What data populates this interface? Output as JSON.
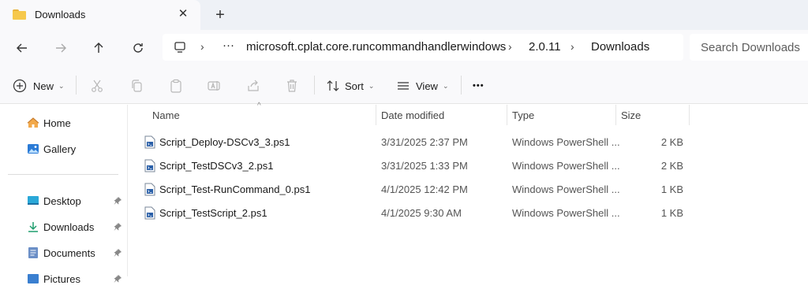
{
  "tab": {
    "title": "Downloads",
    "close_glyph": "✕",
    "new_tab_glyph": "+"
  },
  "address": {
    "more_glyph": "···",
    "crumbs": [
      "microsoft.cplat.core.runcommandhandlerwindows",
      "2.0.11",
      "Downloads"
    ],
    "search_placeholder": "Search Downloads"
  },
  "toolbar": {
    "new_label": "New",
    "sort_label": "Sort",
    "view_label": "View",
    "more_glyph": "•••"
  },
  "sidebar": {
    "items": [
      {
        "label": "Home",
        "icon": "home-icon"
      },
      {
        "label": "Gallery",
        "icon": "gallery-icon"
      },
      {
        "label": "Desktop",
        "icon": "desktop-icon",
        "pinned": true
      },
      {
        "label": "Downloads",
        "icon": "download-icon",
        "pinned": true
      },
      {
        "label": "Documents",
        "icon": "documents-icon",
        "pinned": true
      },
      {
        "label": "Pictures",
        "icon": "pictures-icon",
        "pinned": true
      }
    ]
  },
  "columns": {
    "name": "Name",
    "date": "Date modified",
    "type": "Type",
    "size": "Size"
  },
  "files": [
    {
      "name": "Script_Deploy-DSCv3_3.ps1",
      "date": "3/31/2025 2:37 PM",
      "type": "Windows PowerShell ...",
      "size": "2 KB"
    },
    {
      "name": "Script_TestDSCv3_2.ps1",
      "date": "3/31/2025 1:33 PM",
      "type": "Windows PowerShell ...",
      "size": "2 KB"
    },
    {
      "name": "Script_Test-RunCommand_0.ps1",
      "date": "4/1/2025 12:42 PM",
      "type": "Windows PowerShell ...",
      "size": "1 KB"
    },
    {
      "name": "Script_TestScript_2.ps1",
      "date": "4/1/2025 9:30 AM",
      "type": "Windows PowerShell ...",
      "size": "1 KB"
    }
  ],
  "colors": {
    "accent": "#0067c0",
    "folder": "#f6c84b",
    "chrome": "#eef1f6"
  }
}
